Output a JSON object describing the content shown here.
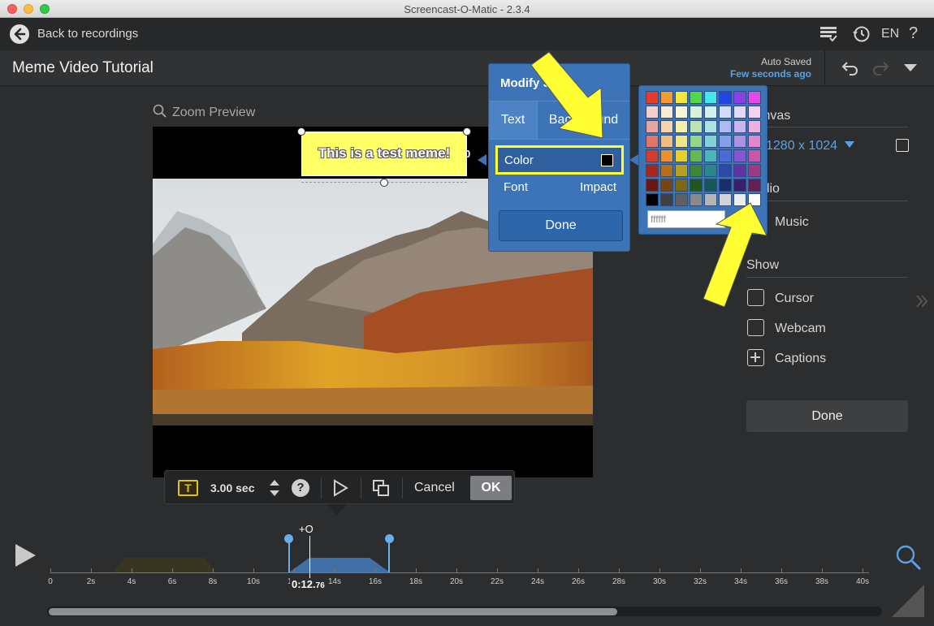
{
  "window": {
    "title": "Screencast-O-Matic - 2.3.4"
  },
  "topnav": {
    "back_label": "Back to recordings",
    "language": "EN",
    "help": "?"
  },
  "project": {
    "title": "Meme Video Tutorial",
    "autosave_label": "Auto Saved",
    "autosave_time": "Few seconds ago"
  },
  "preview": {
    "zoom_label": "Zoom Preview",
    "meme_text": "This is a test meme!",
    "overflow_glyph": "0"
  },
  "mini_toolbar": {
    "type_glyph": "T",
    "duration": "3.00 sec",
    "help": "?",
    "cancel": "Cancel",
    "ok": "OK"
  },
  "modify_style": {
    "title": "Modify Style",
    "tabs": [
      "Text",
      "Background"
    ],
    "active_tab": "Text",
    "color_label": "Color",
    "current_color": "#000000",
    "font_label": "Font",
    "font_value": "Impact",
    "done": "Done"
  },
  "palette": {
    "hex_value": "ffffff",
    "colors": [
      [
        "#e53b2c",
        "#f39a32",
        "#f5e53a",
        "#55d64a",
        "#45e8ea",
        "#2345e8",
        "#8b3fe6",
        "#e54ae6"
      ],
      [
        "#f6cfcb",
        "#faead3",
        "#fbf6d3",
        "#dbf2d6",
        "#d3f0f1",
        "#d3dbf6",
        "#e4d8f5",
        "#f5d3ee"
      ],
      [
        "#eca59d",
        "#f6d4ad",
        "#f8eeac",
        "#bbe4b0",
        "#ade2e4",
        "#adbcf0",
        "#cbb5ec",
        "#eeb0e0"
      ],
      [
        "#e37567",
        "#f2bd80",
        "#f3e48a",
        "#94d68a",
        "#82d3d6",
        "#86a0e8",
        "#ad91e3",
        "#e287cc"
      ],
      [
        "#d33b2b",
        "#e8922e",
        "#e8cf2c",
        "#67b755",
        "#4ab6b8",
        "#4b6bd2",
        "#8757cf",
        "#c957ab"
      ],
      [
        "#a5281d",
        "#b56d20",
        "#b79f21",
        "#3e8633",
        "#2c8789",
        "#2b4aa6",
        "#5e34a2",
        "#9c3a82"
      ],
      [
        "#6c1610",
        "#774514",
        "#7b6a14",
        "#22561e",
        "#185758",
        "#172f6d",
        "#3c1f6b",
        "#661f53"
      ],
      [
        "#000000",
        "#404040",
        "#606060",
        "#8a8a8a",
        "#b4b4b4",
        "#d4d4d4",
        "#ececec",
        "#ffffff"
      ]
    ]
  },
  "right_panel": {
    "canvas_heading": "Canvas",
    "canvas_size": "1280 x 1024",
    "audio_heading": "Audio",
    "music_label": "Music",
    "show_heading": "Show",
    "cursor_label": "Cursor",
    "webcam_label": "Webcam",
    "captions_label": "Captions",
    "done": "Done"
  },
  "timeline": {
    "ticks": [
      "0",
      "2s",
      "4s",
      "6s",
      "8s",
      "10s",
      "12s",
      "14s",
      "16s",
      "18s",
      "20s",
      "22s",
      "24s",
      "26s",
      "28s",
      "30s",
      "32s",
      "34s",
      "36s",
      "38s",
      "40s"
    ],
    "playhead_main": "0:12.",
    "playhead_fraction": "76",
    "playhead_marker": "+O",
    "playhead_seconds": 12.76
  }
}
